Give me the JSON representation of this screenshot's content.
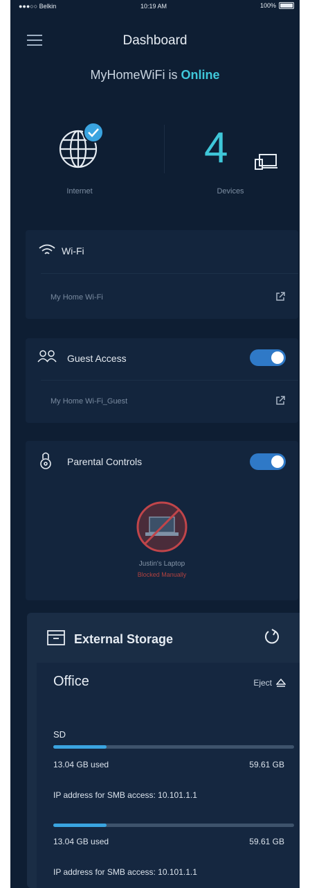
{
  "status_bar": {
    "carrier": "●●●○○ Belkin",
    "time": "10:19 AM",
    "battery": "100%"
  },
  "header": {
    "title": "Dashboard"
  },
  "network": {
    "name_prefix": "MyHomeWiFi is ",
    "status": "Online"
  },
  "tiles": {
    "internet": {
      "label": "Internet",
      "icon": "globe-check-icon"
    },
    "devices": {
      "count": "4",
      "label": "Devices",
      "icon": "devices-icon"
    }
  },
  "wifi_card": {
    "title": "Wi-Fi",
    "network": "My Home Wi-Fi",
    "icon": "wifi-icon"
  },
  "guest_card": {
    "title": "Guest Access",
    "network": "My Home Wi-Fi_Guest",
    "enabled": true,
    "icon": "people-icon"
  },
  "parental_card": {
    "title": "Parental Controls",
    "enabled": true,
    "icon": "padlock-icon",
    "device": {
      "name": "Justin's Laptop",
      "state": "Blocked Manually"
    }
  },
  "storage": {
    "title": "External Storage",
    "drive": "Office",
    "eject_label": "Eject",
    "entries": [
      {
        "label": "SD",
        "used": "13.04 GB used",
        "total": "59.61 GB",
        "fraction": 0.22,
        "ip_text": "IP address for SMB access: 10.101.1.1"
      },
      {
        "label": "",
        "used": "13.04 GB used",
        "total": "59.61 GB",
        "fraction": 0.22,
        "ip_text": "IP address for SMB access: 10.101.1.1"
      }
    ]
  },
  "colors": {
    "background": "#0e1e33",
    "accent": "#3fc7d9",
    "toggle": "#2f79c7",
    "blocked": "#b0413f"
  }
}
